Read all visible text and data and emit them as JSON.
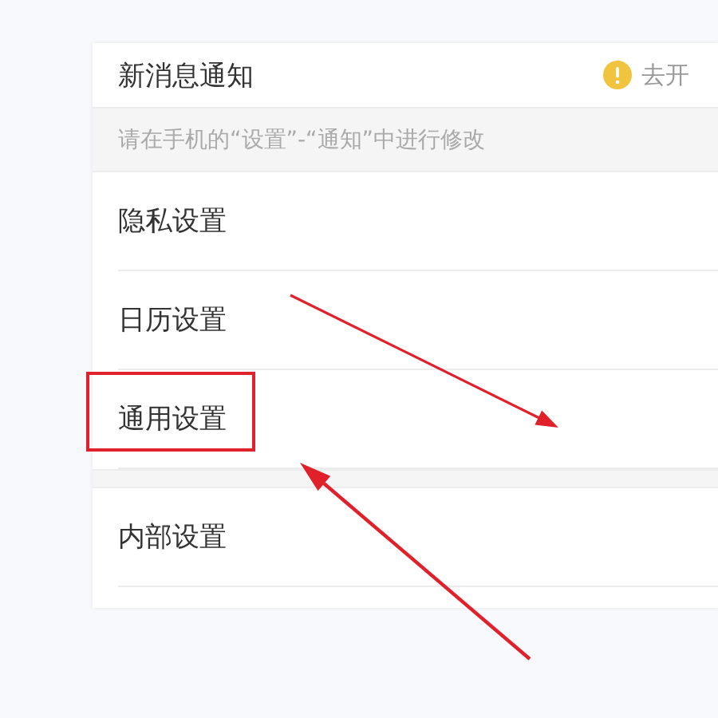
{
  "notification": {
    "title": "新消息通知",
    "status": "去开",
    "hint": "请在手机的“设置”-“通知”中进行修改"
  },
  "groups": [
    {
      "items": [
        {
          "label": "隐私设置",
          "highlighted": false
        },
        {
          "label": "日历设置",
          "highlighted": false
        },
        {
          "label": "通用设置",
          "highlighted": true
        }
      ]
    },
    {
      "items": [
        {
          "label": "内部设置",
          "highlighted": false
        }
      ]
    }
  ]
}
